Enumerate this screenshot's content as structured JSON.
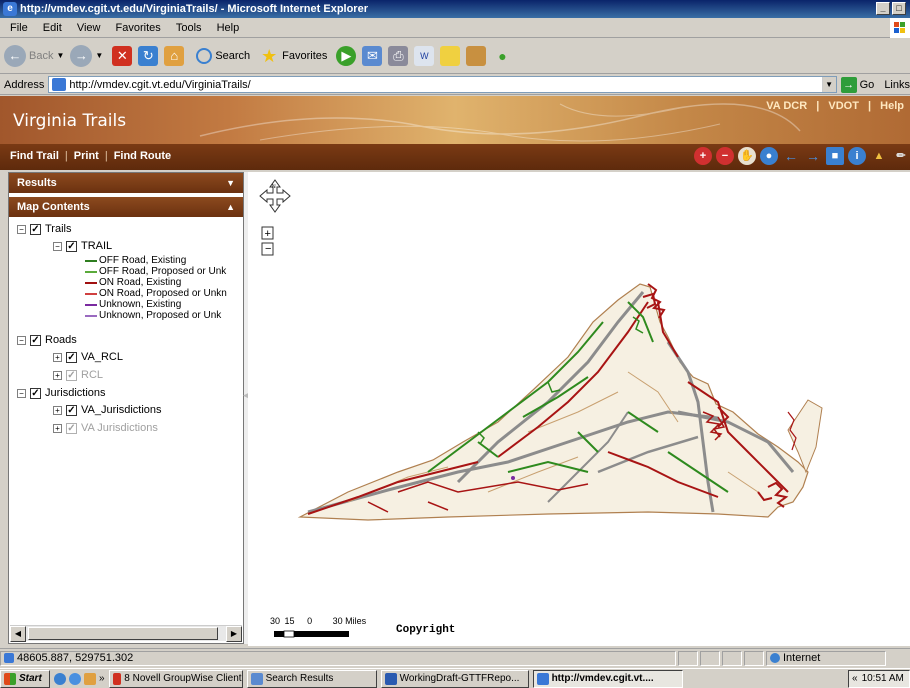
{
  "window": {
    "title": "http://vmdev.cgit.vt.edu/VirginiaTrails/ - Microsoft Internet Explorer",
    "buttons": [
      "_",
      "□"
    ]
  },
  "menu": [
    "File",
    "Edit",
    "View",
    "Favorites",
    "Tools",
    "Help"
  ],
  "toolbar": {
    "back": "Back",
    "search": "Search",
    "favorites": "Favorites"
  },
  "address": {
    "label": "Address",
    "url": "http://vmdev.cgit.vt.edu/VirginiaTrails/",
    "go": "Go",
    "links": "Links"
  },
  "site": {
    "title": "Virginia Trails",
    "top_links": [
      "VA DCR",
      "VDOT",
      "Help"
    ],
    "nav": [
      "Find Trail",
      "Print",
      "Find Route"
    ]
  },
  "panels": {
    "results": "Results",
    "map_contents": "Map Contents"
  },
  "tree": {
    "trails": "Trails",
    "trail": "TRAIL",
    "legend": [
      {
        "label": "OFF Road, Existing",
        "color": "#2e7d1f",
        "style": "solid"
      },
      {
        "label": "OFF Road, Proposed or Unk",
        "color": "#5aaa3a",
        "style": "dashed"
      },
      {
        "label": "ON Road, Existing",
        "color": "#a01010",
        "style": "solid"
      },
      {
        "label": "ON Road, Proposed or Unkn",
        "color": "#d04040",
        "style": "dashed"
      },
      {
        "label": "Unknown, Existing",
        "color": "#7a2aa0",
        "style": "solid"
      },
      {
        "label": "Unknown, Proposed or Unk",
        "color": "#9a6ac0",
        "style": "dashed"
      }
    ],
    "roads": "Roads",
    "va_rcl": "VA_RCL",
    "rcl": "RCL",
    "jurisdictions": "Jurisdictions",
    "va_jurisdictions": "VA_Jurisdictions",
    "va_jurisdictions_dim": "VA Jurisdictions"
  },
  "map": {
    "scale_labels": [
      "30",
      "15",
      "0",
      "30 Miles"
    ],
    "copyright": "Copyright",
    "colors": {
      "state": "#f4eede",
      "border": "#b08050",
      "roads": "#8c8c8c",
      "on_road": "#a81414",
      "off_road": "#2e8a1e",
      "tan_roads": "#c8a070"
    }
  },
  "status": {
    "coords": "48605.887, 529751.302",
    "zone": "Internet"
  },
  "taskbar": {
    "start": "Start",
    "items": [
      "8 Novell GroupWise Client",
      "Search Results",
      "WorkingDraft-GTTFRepo...",
      "http://vmdev.cgit.vt...."
    ],
    "clock": "10:51 AM"
  }
}
